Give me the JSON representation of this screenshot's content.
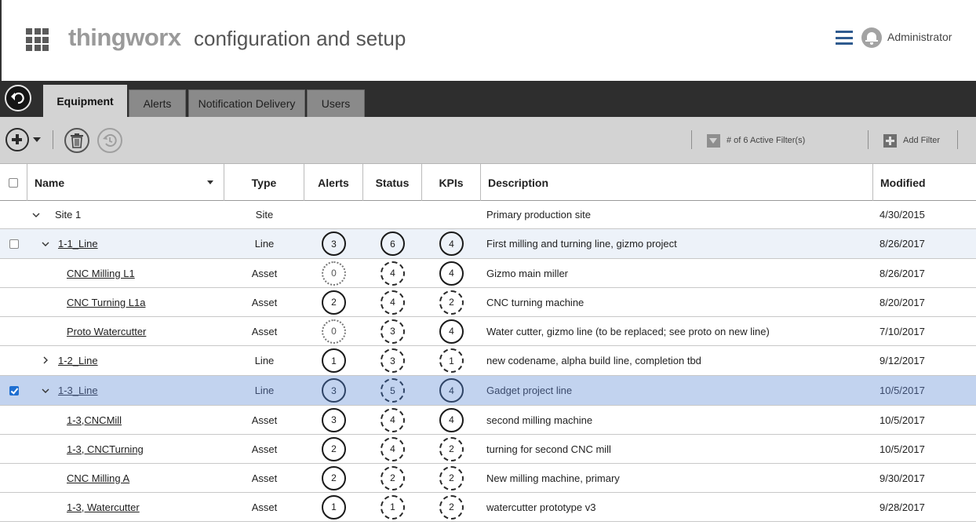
{
  "header": {
    "brand": "thingworx",
    "subtitle": "configuration and setup",
    "user": "Administrator"
  },
  "tabs": [
    {
      "label": "Equipment",
      "active": true
    },
    {
      "label": "Alerts",
      "active": false
    },
    {
      "label": "Notification Delivery",
      "active": false
    },
    {
      "label": "Users",
      "active": false
    }
  ],
  "toolbar": {
    "filter_label": "# of 6 Active Filter(s)",
    "add_filter_label": "Add Filter"
  },
  "table": {
    "columns": [
      "Name",
      "Type",
      "Alerts",
      "Status",
      "KPIs",
      "Description",
      "Modified"
    ],
    "rows": [
      {
        "name": "Site 1",
        "type": "Site",
        "alerts": "",
        "status": "",
        "kpis": "",
        "description": "Primary production site",
        "modified": "4/30/2015"
      },
      {
        "name": "1-1_Line",
        "type": "Line",
        "alerts": "3",
        "status": "6",
        "kpis": "4",
        "description": "First milling and turning line, gizmo project",
        "modified": "8/26/2017"
      },
      {
        "name": "CNC Milling L1",
        "type": "Asset",
        "alerts": "0",
        "status": "4",
        "kpis": "4",
        "description": "Gizmo main miller",
        "modified": "8/26/2017"
      },
      {
        "name": "CNC Turning L1a",
        "type": "Asset",
        "alerts": "2",
        "status": "4",
        "kpis": "2",
        "description": "CNC turning machine",
        "modified": "8/20/2017"
      },
      {
        "name": "Proto Watercutter",
        "type": "Asset",
        "alerts": "0",
        "status": "3",
        "kpis": "4",
        "description": "Water cutter, gizmo line (to be replaced; see proto on new line)",
        "modified": "7/10/2017"
      },
      {
        "name": "1-2_Line",
        "type": "Line",
        "alerts": "1",
        "status": "3",
        "kpis": "1",
        "description": "new codename, alpha build line, completion tbd",
        "modified": "9/12/2017"
      },
      {
        "name": "1-3_Line",
        "type": "Line",
        "alerts": "3",
        "status": "5",
        "kpis": "4",
        "description": "Gadget project line",
        "modified": "10/5/2017"
      },
      {
        "name": "1-3,CNCMill",
        "type": "Asset",
        "alerts": "3",
        "status": "4",
        "kpis": "4",
        "description": "second milling machine",
        "modified": "10/5/2017"
      },
      {
        "name": "1-3, CNCTurning",
        "type": "Asset",
        "alerts": "2",
        "status": "4",
        "kpis": "2",
        "description": "turning for second CNC mill",
        "modified": "10/5/2017"
      },
      {
        "name": "CNC Milling A",
        "type": "Asset",
        "alerts": "2",
        "status": "2",
        "kpis": "2",
        "description": "New milling machine, primary",
        "modified": "9/30/2017"
      },
      {
        "name": "1-3, Watercutter",
        "type": "Asset",
        "alerts": "1",
        "status": "1",
        "kpis": "2",
        "description": "watercutter prototype v3",
        "modified": "9/28/2017"
      }
    ]
  },
  "colors": {
    "tabbar": "#2e2e2e",
    "toolbar": "#d3d3d3",
    "selected_row": "#c2d3ef",
    "accent": "#2f5b8f"
  }
}
